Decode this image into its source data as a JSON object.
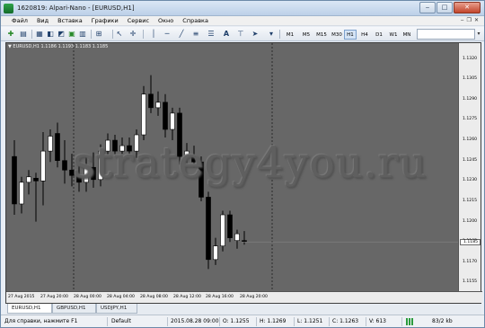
{
  "window": {
    "title": "1620819: Alpari-Nano - [EURUSD,H1]",
    "buttons": {
      "minimize": "‒",
      "maximize": "□",
      "close": "✕"
    }
  },
  "menu": {
    "items": [
      "Файл",
      "Вид",
      "Вставка",
      "Графики",
      "Сервис",
      "Окно",
      "Справка"
    ],
    "mdi": {
      "minimize": "‒",
      "restore": "❐",
      "close": "✕"
    }
  },
  "toolbar": {
    "timeframes": [
      "M1",
      "M5",
      "M15",
      "M30",
      "H1",
      "H4",
      "D1",
      "W1",
      "MN"
    ],
    "active_timeframe": "H1"
  },
  "chart": {
    "header": "▼ EURUSD,H1  1.1186 1.1193 1.1183 1.1185",
    "watermark": "strategy4you.ru",
    "background": "#676767",
    "price_ticks": [
      "1.1320",
      "1.1305",
      "1.1290",
      "1.1275",
      "1.1260",
      "1.1245",
      "1.1230",
      "1.1215",
      "1.1200",
      "1.1185",
      "1.1170",
      "1.1155"
    ],
    "current_price": "1.1185",
    "time_ticks": [
      "27 Aug 2015",
      "27 Aug 20:00",
      "28 Aug 00:00",
      "28 Aug 04:00",
      "28 Aug 08:00",
      "28 Aug 12:00",
      "28 Aug 16:00",
      "28 Aug 20:00"
    ]
  },
  "chart_data": {
    "type": "candlestick",
    "symbol": "EURUSD",
    "timeframe": "H1",
    "ylim": [
      1.115,
      1.1325
    ],
    "bull_color": "#ffffff",
    "bear_color": "#000000",
    "candles": [
      {
        "o": 1.1248,
        "h": 1.126,
        "l": 1.1205,
        "c": 1.1213
      },
      {
        "o": 1.1213,
        "h": 1.1233,
        "l": 1.1206,
        "c": 1.1229
      },
      {
        "o": 1.1229,
        "h": 1.1238,
        "l": 1.122,
        "c": 1.1233
      },
      {
        "o": 1.1232,
        "h": 1.1236,
        "l": 1.12,
        "c": 1.123
      },
      {
        "o": 1.123,
        "h": 1.1266,
        "l": 1.1212,
        "c": 1.1252
      },
      {
        "o": 1.1252,
        "h": 1.1268,
        "l": 1.1244,
        "c": 1.1263
      },
      {
        "o": 1.1265,
        "h": 1.1273,
        "l": 1.124,
        "c": 1.1245
      },
      {
        "o": 1.1245,
        "h": 1.126,
        "l": 1.1228,
        "c": 1.1238
      },
      {
        "o": 1.1238,
        "h": 1.125,
        "l": 1.1226,
        "c": 1.1234
      },
      {
        "o": 1.1234,
        "h": 1.1248,
        "l": 1.1222,
        "c": 1.1229
      },
      {
        "o": 1.1229,
        "h": 1.1248,
        "l": 1.1222,
        "c": 1.124
      },
      {
        "o": 1.124,
        "h": 1.1251,
        "l": 1.1225,
        "c": 1.1231
      },
      {
        "o": 1.1231,
        "h": 1.1257,
        "l": 1.1226,
        "c": 1.1252
      },
      {
        "o": 1.1252,
        "h": 1.1265,
        "l": 1.1247,
        "c": 1.126
      },
      {
        "o": 1.126,
        "h": 1.1264,
        "l": 1.1248,
        "c": 1.1252
      },
      {
        "o": 1.1252,
        "h": 1.1262,
        "l": 1.125,
        "c": 1.1256
      },
      {
        "o": 1.1256,
        "h": 1.1262,
        "l": 1.1248,
        "c": 1.1252
      },
      {
        "o": 1.1252,
        "h": 1.1268,
        "l": 1.1247,
        "c": 1.1264
      },
      {
        "o": 1.1264,
        "h": 1.13,
        "l": 1.126,
        "c": 1.1294
      },
      {
        "o": 1.1294,
        "h": 1.1308,
        "l": 1.128,
        "c": 1.1284
      },
      {
        "o": 1.1284,
        "h": 1.1296,
        "l": 1.1278,
        "c": 1.1288
      },
      {
        "o": 1.1288,
        "h": 1.1294,
        "l": 1.1262,
        "c": 1.1268
      },
      {
        "o": 1.1268,
        "h": 1.1284,
        "l": 1.126,
        "c": 1.128
      },
      {
        "o": 1.128,
        "h": 1.1284,
        "l": 1.1242,
        "c": 1.1248
      },
      {
        "o": 1.1248,
        "h": 1.1258,
        "l": 1.124,
        "c": 1.1252
      },
      {
        "o": 1.1248,
        "h": 1.1256,
        "l": 1.124,
        "c": 1.1244
      },
      {
        "o": 1.1244,
        "h": 1.1248,
        "l": 1.1215,
        "c": 1.1218
      },
      {
        "o": 1.1218,
        "h": 1.1222,
        "l": 1.1165,
        "c": 1.1172
      },
      {
        "o": 1.1172,
        "h": 1.1188,
        "l": 1.1168,
        "c": 1.1182
      },
      {
        "o": 1.1182,
        "h": 1.1208,
        "l": 1.1178,
        "c": 1.1205
      },
      {
        "o": 1.1205,
        "h": 1.1208,
        "l": 1.1185,
        "c": 1.1188
      },
      {
        "o": 1.1186,
        "h": 1.1194,
        "l": 1.118,
        "c": 1.1191
      },
      {
        "o": 1.1186,
        "h": 1.1193,
        "l": 1.1183,
        "c": 1.1185
      }
    ]
  },
  "tabs": {
    "items": [
      "EURUSD,H1",
      "GBPUSD,H1",
      "USDJPY,H1"
    ],
    "active": "EURUSD,H1"
  },
  "status": {
    "help": "Для справки, нажмите F1",
    "profile": "Default",
    "datetime": "2015.08.28 09:00",
    "open": "O: 1.1255",
    "high": "H: 1.1269",
    "low": "L: 1.1251",
    "close": "C: 1.1263",
    "volume": "V: 613",
    "traffic": "83/2 kb"
  }
}
